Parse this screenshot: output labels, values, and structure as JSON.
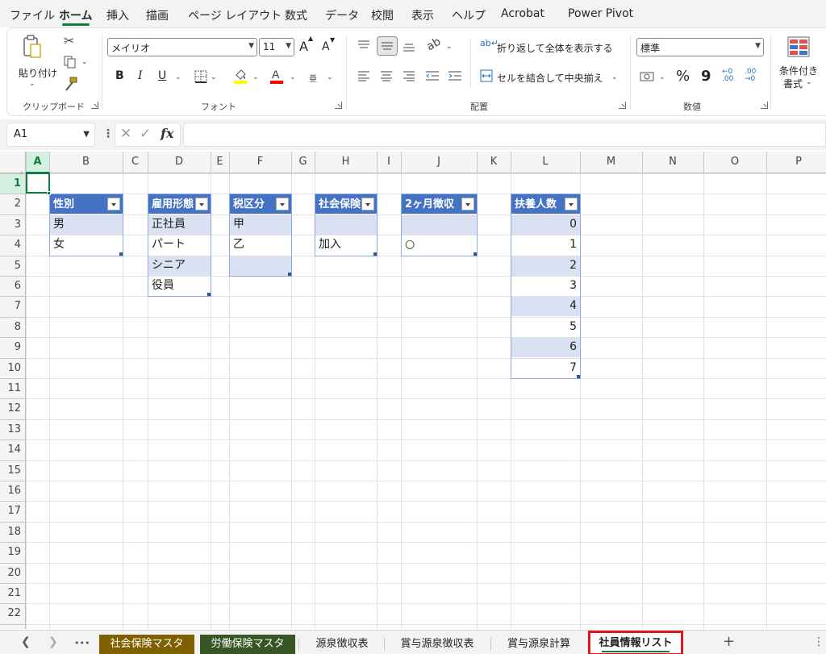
{
  "menu": {
    "tabs": [
      "ファイル",
      "ホーム",
      "挿入",
      "描画",
      "ページ レイアウト",
      "数式",
      "データ",
      "校閲",
      "表示",
      "ヘルプ",
      "Acrobat",
      "Power Pivot"
    ],
    "active_tab": "ホーム"
  },
  "ribbon": {
    "clipboard": {
      "paste_label": "貼り付け",
      "group_label": "クリップボード"
    },
    "font": {
      "name": "メイリオ",
      "size": "11",
      "group_label": "フォント",
      "bold": "B",
      "italic": "I",
      "underline": "U",
      "grow": "A",
      "shrink": "A",
      "phonetic": "亜",
      "fill_color": "#ffff00",
      "font_color": "#ff0000"
    },
    "alignment": {
      "wrap_text": "折り返して全体を表示する",
      "merge_center": "セルを結合して中央揃え",
      "group_label": "配置"
    },
    "number": {
      "format": "標準",
      "percent": "%",
      "comma": "9",
      "group_label": "数値"
    },
    "styles": {
      "conditional_line1": "条件付き",
      "conditional_line2": "書式"
    }
  },
  "formula_bar": {
    "name_box": "A1",
    "fx": "fx",
    "value": ""
  },
  "grid": {
    "columns": [
      "A",
      "B",
      "C",
      "D",
      "E",
      "F",
      "G",
      "H",
      "I",
      "J",
      "K",
      "L",
      "M",
      "N",
      "O",
      "P"
    ],
    "rows": [
      "1",
      "2",
      "3",
      "4",
      "5",
      "6",
      "7",
      "8",
      "9",
      "10",
      "11",
      "12",
      "13",
      "14",
      "15",
      "16",
      "17",
      "18",
      "19",
      "20",
      "21",
      "22"
    ],
    "selected_cell": "A1"
  },
  "tables": {
    "gender": {
      "header": "性別",
      "values": [
        "男",
        "女"
      ]
    },
    "employment": {
      "header": "雇用形態",
      "values": [
        "正社員",
        "パート",
        "シニア",
        "役員"
      ]
    },
    "tax": {
      "header": "税区分",
      "values": [
        "甲",
        "乙",
        ""
      ]
    },
    "social": {
      "header": "社会保険",
      "values": [
        "",
        "加入"
      ]
    },
    "two_month": {
      "header": "2ヶ月徴収",
      "values": [
        "",
        "○"
      ]
    },
    "dependents": {
      "header": "扶養人数",
      "values": [
        "0",
        "1",
        "2",
        "3",
        "4",
        "5",
        "6",
        "7"
      ]
    }
  },
  "sheet_tabs": {
    "more": "•••",
    "tabs": [
      {
        "label": "社会保険マスタ",
        "color": "#7f6000"
      },
      {
        "label": "労働保険マスタ",
        "color": "#375623"
      },
      {
        "label": "源泉徴収表",
        "color": ""
      },
      {
        "label": "賞与源泉徴収表",
        "color": ""
      },
      {
        "label": "賞与源泉計算",
        "color": ""
      },
      {
        "label": "社員情報リスト",
        "color": ""
      }
    ],
    "active": "社員情報リスト",
    "add": "+",
    "options": "⋮"
  }
}
